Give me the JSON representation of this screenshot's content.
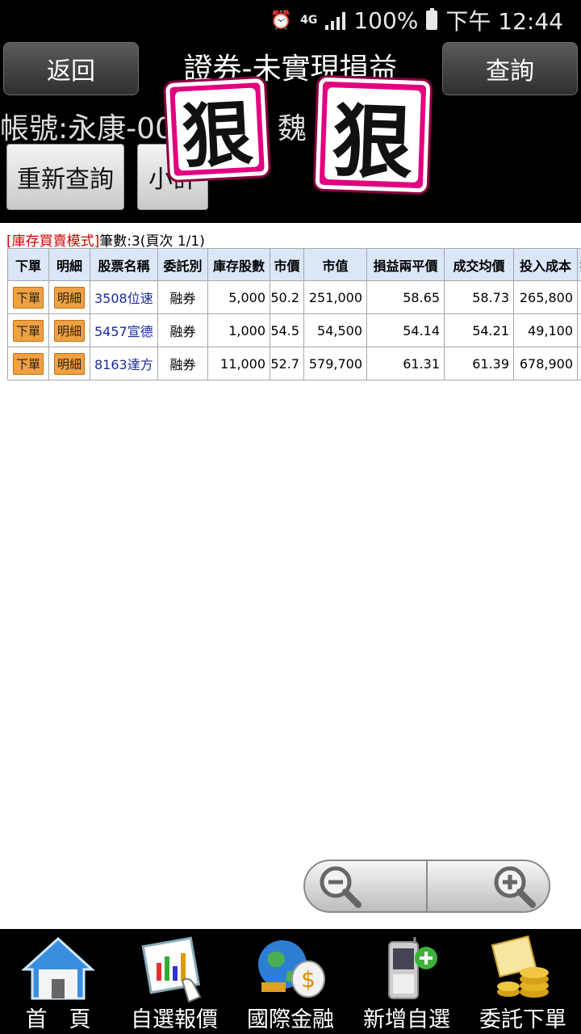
{
  "status_bar": {
    "network": "4G",
    "battery": "100%",
    "time": "下午 12:44"
  },
  "header": {
    "back_label": "返回",
    "title": "證券-未實現損益",
    "query_label": "查詢",
    "account": "帳號:永康-00",
    "account_name": "魏",
    "requery_label": "重新查詢",
    "subtotal_label": "小計",
    "sticker_text": "狠"
  },
  "info": {
    "mode": "[庫存買賣模式]",
    "count": "筆數:3(頁次 1/1)"
  },
  "table": {
    "headers": [
      "下單",
      "明細",
      "股票名稱",
      "委託別",
      "庫存股數",
      "市價",
      "市值",
      "損益兩平價",
      "成交均價",
      "投入成本",
      "投"
    ],
    "rows": [
      {
        "order": "下單",
        "detail": "明細",
        "stock": "3508位速",
        "type": "融券",
        "shares": "5,000",
        "price": "50.2",
        "value": "251,000",
        "breakeven": "58.65",
        "avg": "58.73",
        "cost": "265,800",
        "extra": "+"
      },
      {
        "order": "下單",
        "detail": "明細",
        "stock": "5457宣德",
        "type": "融券",
        "shares": "1,000",
        "price": "54.5",
        "value": "54,500",
        "breakeven": "54.14",
        "avg": "54.21",
        "cost": "49,100",
        "extra": ""
      },
      {
        "order": "下單",
        "detail": "明細",
        "stock": "8163達方",
        "type": "融券",
        "shares": "11,000",
        "price": "52.7",
        "value": "579,700",
        "breakeven": "61.31",
        "avg": "61.39",
        "cost": "678,900",
        "extra": "+"
      }
    ]
  },
  "zoom": {
    "out_icon": "zoom-out-icon",
    "in_icon": "zoom-in-icon"
  },
  "bottom_nav": [
    {
      "label": "首　頁",
      "icon": "home-icon"
    },
    {
      "label": "自選報價",
      "icon": "quote-chart-icon"
    },
    {
      "label": "國際金融",
      "icon": "globe-money-icon"
    },
    {
      "label": "新增自選",
      "icon": "phone-add-icon"
    },
    {
      "label": "委託下單",
      "icon": "coins-order-icon"
    }
  ]
}
